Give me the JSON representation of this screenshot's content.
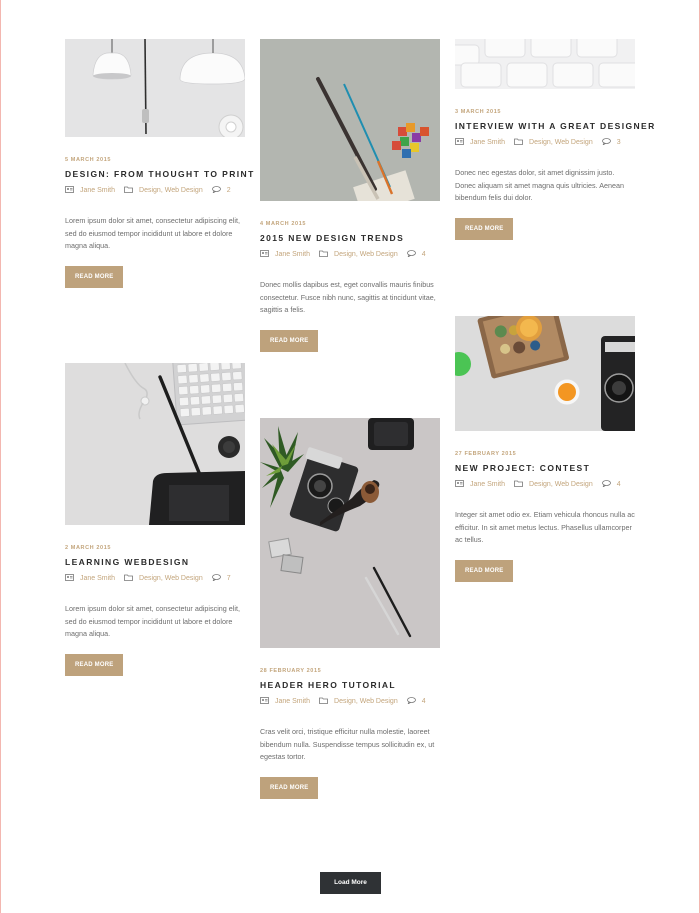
{
  "posts": [
    {
      "date": "5 March 2015",
      "title": "Design: From Thought to Print",
      "author": "Jane Smith",
      "categories": "Design, Web Design",
      "comments": "2",
      "excerpt": "Lorem ipsum dolor sit amet, consectetur adipiscing elit, sed do eiusmod tempor incididunt ut labore et dolore magna aliqua.",
      "button": "Read More",
      "image": "desk-lamps-photo"
    },
    {
      "date": "4 March 2015",
      "title": "2015 New Design Trends",
      "author": "Jane Smith",
      "categories": "Design, Web Design",
      "comments": "4",
      "excerpt": "Donec mollis dapibus est, eget convallis mauris finibus consectetur. Fusce nibh nunc, sagittis at tincidunt vitae, sagittis a felis.",
      "button": "Read More",
      "image": "paintbrushes-photo"
    },
    {
      "date": "3 March 2015",
      "title": "Interview with a Great Designer",
      "author": "Jane Smith",
      "categories": "Design, Web Design",
      "comments": "3",
      "excerpt": "Donec nec egestas dolor, sit amet dignissim justo. Donec aliquam sit amet magna quis ultricies. Aenean bibendum felis dui dolor.",
      "button": "Read More",
      "image": "keyboard-photo"
    },
    {
      "date": "2 March 2015",
      "title": "Learning Webdesign",
      "author": "Jane Smith",
      "categories": "Design, Web Design",
      "comments": "7",
      "excerpt": "Lorem ipsum dolor sit amet, consectetur adipiscing elit, sed do eiusmod tempor incididunt ut labore et dolore magna aliqua.",
      "button": "Read More",
      "image": "keyboard-tablet-photo"
    },
    {
      "date": "28 February 2015",
      "title": "Header Hero Tutorial",
      "author": "Jane Smith",
      "categories": "Design, Web Design",
      "comments": "4",
      "excerpt": "Cras velit orci, tristique efficitur nulla molestie, laoreet bibendum nulla. Suspendisse tempus sollicitudin ex, ut egestas tortor.",
      "button": "Read More",
      "image": "camera-pipe-photo"
    },
    {
      "date": "27 February 2015",
      "title": "New Project: Contest",
      "author": "Jane Smith",
      "categories": "Design, Web Design",
      "comments": "4",
      "excerpt": "Integer sit amet odio ex. Etiam vehicula rhoncus nulla ac efficitur. In sit amet metus lectus. Phasellus ullamcorper ac tellus.",
      "button": "Read More",
      "image": "paint-box-camera-photo"
    }
  ],
  "load_more": "Load More",
  "colors": {
    "accent": "#bea27c",
    "dark_button": "#2f3235",
    "title": "#2b2b2b",
    "text": "#6d6d6d"
  },
  "icons": {
    "author": "user-card-icon",
    "categories": "folder-icon",
    "comments": "comment-bubble-icon"
  }
}
